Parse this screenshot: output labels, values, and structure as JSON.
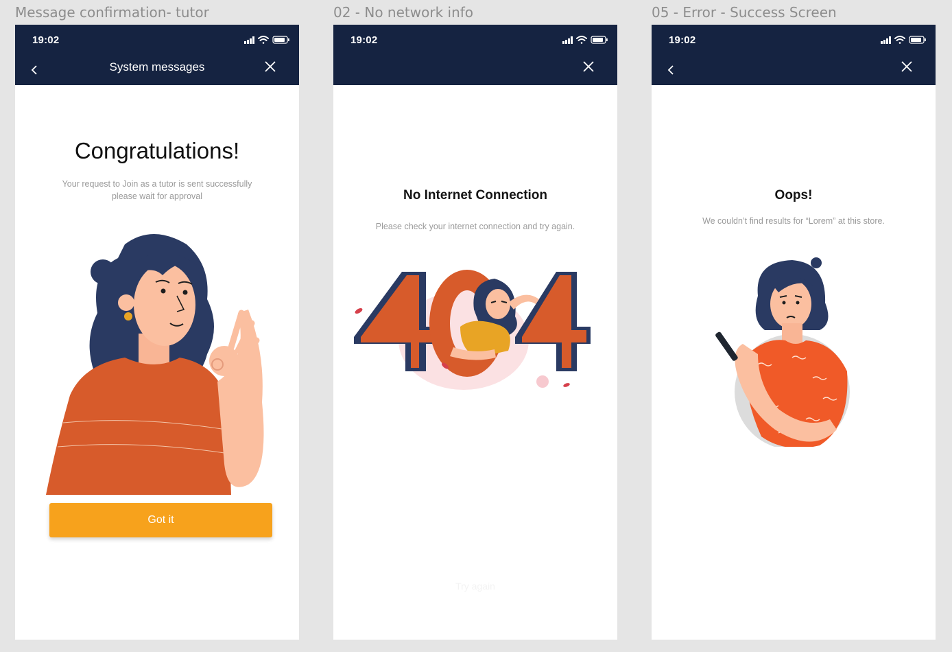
{
  "frames": [
    {
      "label": "Message confirmation- tutor",
      "status_time": "19:02",
      "nav_title": "System messages",
      "heading": "Congratulations!",
      "message_line1": "Your request to Join as a tutor is sent successfully",
      "message_line2": "please wait for approval",
      "button_label": "Got it",
      "illustration": "woman-ok-gesture"
    },
    {
      "label": "02 - No network info",
      "status_time": "19:02",
      "heading": "No Internet Connection",
      "message": "Please check your internet connection and try again.",
      "button_label": "Try again",
      "illustration": "404-woman-searching"
    },
    {
      "label": "05 - Error - Success Screen",
      "status_time": "19:02",
      "heading": "Oops!",
      "message": "We couldn’t find results for “Lorem” at this store.",
      "illustration": "confused-woman-phone"
    }
  ],
  "icons": {
    "back": "chevron-left-icon",
    "close": "close-icon",
    "signal": "signal-icon",
    "wifi": "wifi-icon",
    "battery": "battery-icon"
  },
  "colors": {
    "navbar": "#152341",
    "accent_button": "#f7a21c",
    "illustration_orange": "#d75b2b",
    "illustration_navy": "#2a3a62",
    "skin": "#fbbfa0"
  }
}
